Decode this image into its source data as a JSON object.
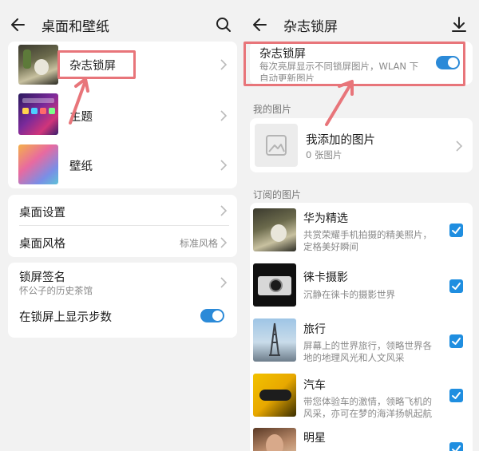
{
  "left": {
    "header": {
      "title": "桌面和壁纸",
      "back_icon": "back-arrow-icon",
      "action_icon": "search-icon"
    },
    "items": [
      {
        "label": "杂志锁屏",
        "icon": "magazine-thumbnail"
      },
      {
        "label": "主题",
        "icon": "theme-thumbnail"
      },
      {
        "label": "壁纸",
        "icon": "wallpaper-thumbnail"
      }
    ],
    "settings": [
      {
        "label": "桌面设置"
      },
      {
        "label": "桌面风格",
        "value": "标准风格"
      }
    ],
    "lock": {
      "signature_label": "锁屏签名",
      "signature_value": "怀公子的历史茶馆",
      "steps_label": "在锁屏上显示步数",
      "steps_enabled": true
    }
  },
  "right": {
    "header": {
      "title": "杂志锁屏",
      "back_icon": "back-arrow-icon",
      "action_icon": "download-icon"
    },
    "magazine": {
      "label": "杂志锁屏",
      "desc_line1": "每次亮屏显示不同锁屏图片，WLAN 下",
      "desc_line2": "自动更新图片",
      "enabled": true
    },
    "my_pictures": {
      "section_label": "我的图片",
      "title": "我添加的图片",
      "count": "0 张图片"
    },
    "subscribed": {
      "section_label": "订阅的图片",
      "items": [
        {
          "title": "华为精选",
          "desc_line1": "共赏荣耀手机拍摄的精美照片，",
          "desc_line2": "定格美好瞬间",
          "checked": true
        },
        {
          "title": "徕卡摄影",
          "desc_line1": "沉静在徕卡的摄影世界",
          "desc_line2": "",
          "checked": true
        },
        {
          "title": "旅行",
          "desc_line1": "屏幕上的世界旅行，领略世界各",
          "desc_line2": "地的地理风光和人文风采",
          "checked": true
        },
        {
          "title": "汽车",
          "desc_line1": "带您体验车的激情，领略飞机的",
          "desc_line2": "风采，亦可在梦的海洋扬帆起航",
          "checked": true
        },
        {
          "title": "明星",
          "desc_line1": "",
          "desc_line2": "",
          "checked": true
        }
      ]
    }
  },
  "colors": {
    "accent": "#2b8ad8",
    "annotation": "#e8757a",
    "background": "#f2f2f2"
  }
}
